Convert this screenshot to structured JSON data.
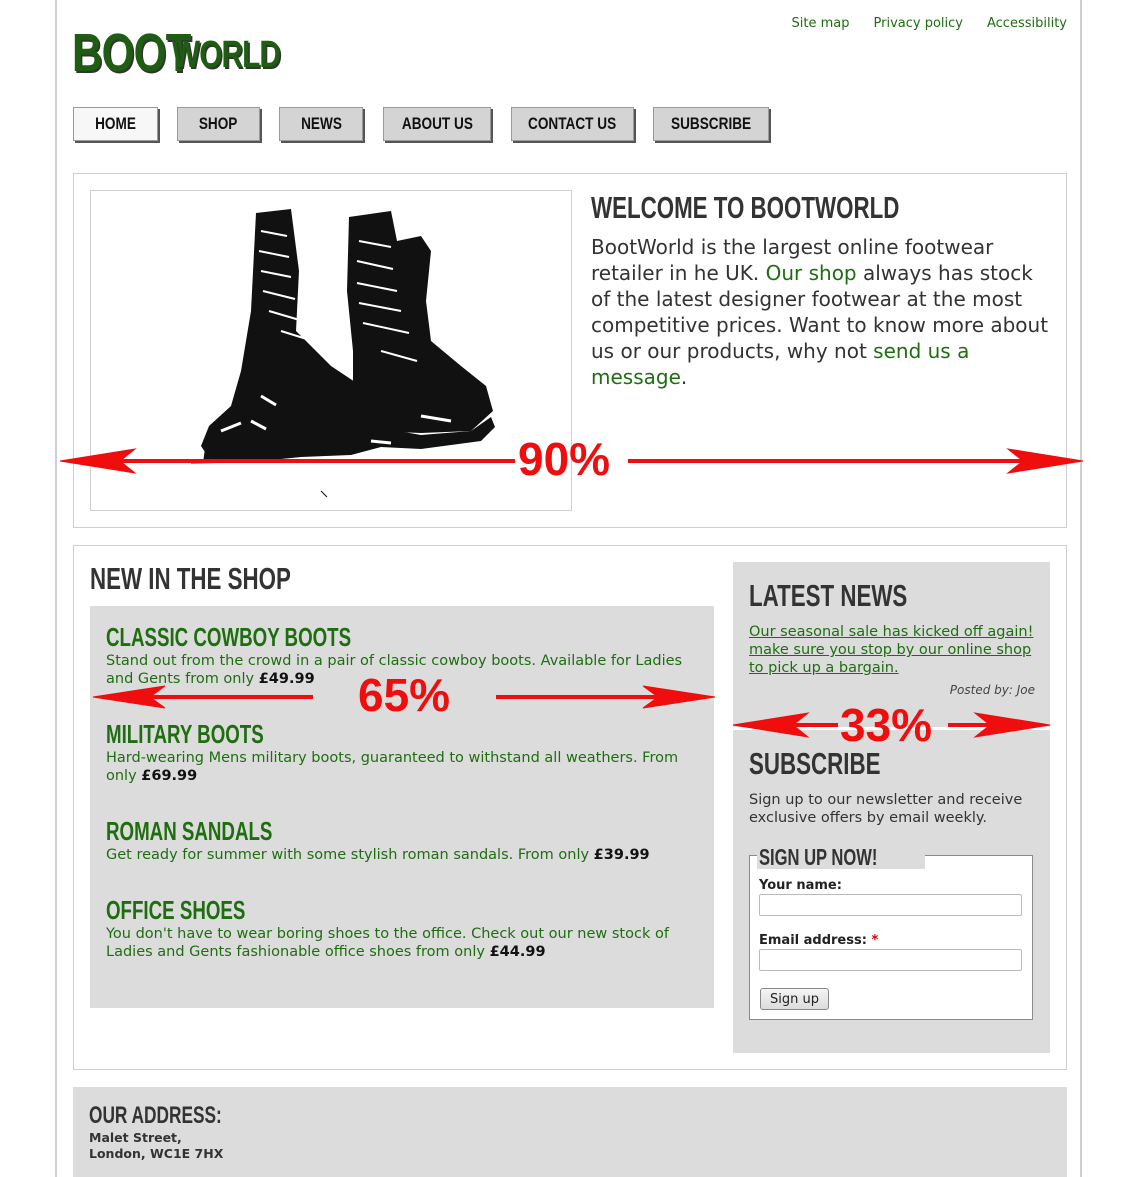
{
  "logo": {
    "part1": "BOOT",
    "part2": "WORLD"
  },
  "top_links": [
    "Site map",
    "Privacy policy",
    "Accessibility"
  ],
  "nav": [
    "HOME",
    "SHOP",
    "NEWS",
    "ABOUT US",
    "CONTACT US",
    "SUBSCRIBE"
  ],
  "welcome": {
    "title": "WELCOME TO BOOTWORLD",
    "text_1": "BootWorld is the largest online footwear retailer in he UK. ",
    "link_1": "Our shop",
    "text_2": " always has stock of the latest designer footwear at the most competitive prices. Want to know more about us or our products, why not ",
    "link_2": "send us a message",
    "text_3": "."
  },
  "shop": {
    "title": "NEW IN THE SHOP",
    "products": [
      {
        "name": "CLASSIC COWBOY BOOTS",
        "desc": "Stand out from the crowd in a pair of classic cowboy boots. Available for Ladies and Gents from only ",
        "price": "£49.99"
      },
      {
        "name": "MILITARY BOOTS",
        "desc": "Hard-wearing Mens military boots, guaranteed to withstand all weathers. From only ",
        "price": "£69.99"
      },
      {
        "name": "ROMAN SANDALS",
        "desc": "Get ready for summer with some stylish roman sandals. From only ",
        "price": "£39.99"
      },
      {
        "name": "OFFICE SHOES",
        "desc": "You don't have to wear boring shoes to the office. Check out our new stock of Ladies and Gents fashionable office shoes from only ",
        "price": "£44.99"
      }
    ]
  },
  "news": {
    "title": "LATEST NEWS",
    "link": "Our seasonal sale has kicked off again! make sure you stop by our online shop to pick up a bargain.",
    "posted": "Posted by: Joe"
  },
  "subscribe": {
    "title": "SUBSCRIBE",
    "text": "Sign up to our newsletter and receive exclusive offers by email weekly.",
    "legend": "SIGN UP NOW!",
    "name_label": "Your name:",
    "email_label": "Email address:",
    "required_mark": "*",
    "button": "Sign up"
  },
  "footer": {
    "title": "OUR ADDRESS:",
    "line1": "Malet Street,",
    "line2": "London, WC1E 7HX"
  },
  "annotations": [
    "90%",
    "65%",
    "33%"
  ],
  "colors": {
    "brand_green": "#1e6e10",
    "panel_grey": "#dcdcdc",
    "annotation_red": "#ef0d0d"
  }
}
